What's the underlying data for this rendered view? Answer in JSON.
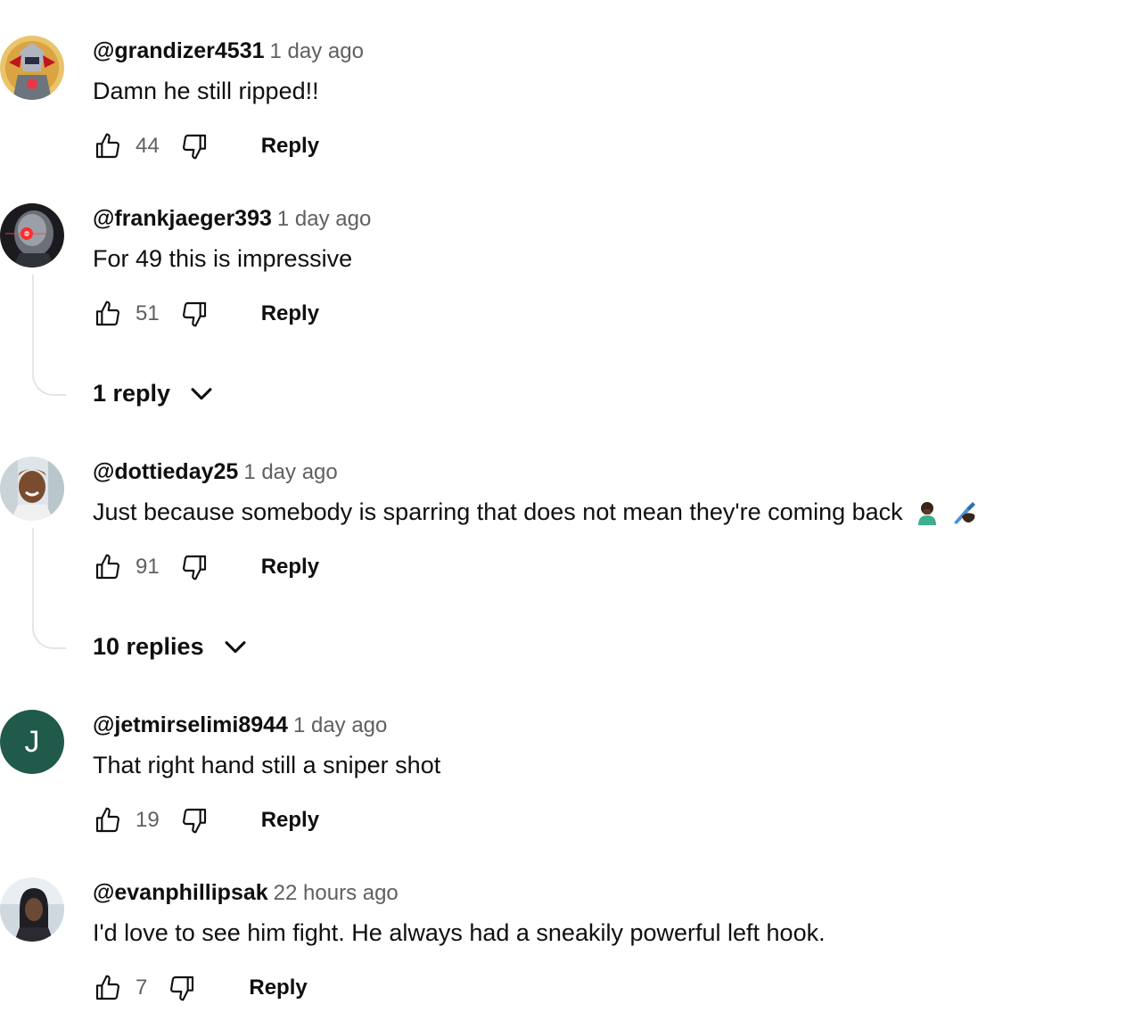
{
  "comments": [
    {
      "author": "@grandizer4531",
      "time": "1 day ago",
      "text": "Damn he still ripped!!",
      "likes": "44",
      "reply_label": "Reply"
    },
    {
      "author": "@frankjaeger393",
      "time": "1 day ago",
      "text": "For 49 this is impressive",
      "likes": "51",
      "reply_label": "Reply",
      "replies_label": "1 reply"
    },
    {
      "author": "@dottieday25",
      "time": "1 day ago",
      "text": "Just because somebody is sparring that does not mean they're coming back",
      "likes": "91",
      "reply_label": "Reply",
      "replies_label": "10 replies"
    },
    {
      "author": "@jetmirselimi8944",
      "time": "1 day ago",
      "text": "That right hand still a sniper shot",
      "likes": "19",
      "reply_label": "Reply",
      "avatar_letter": "J"
    },
    {
      "author": "@evanphillipsak",
      "time": "22 hours ago",
      "text": "I'd love to see him fight.  He always had a sneakily powerful left hook.",
      "likes": "7",
      "reply_label": "Reply"
    }
  ],
  "icons": {
    "like": "thumbs-up-icon",
    "dislike": "thumbs-down-icon",
    "expand": "chevron-down-icon"
  },
  "colors": {
    "muted_text": "#606060",
    "thread_line": "#e5e5e5",
    "avatar_j": "#1f5a4a"
  }
}
